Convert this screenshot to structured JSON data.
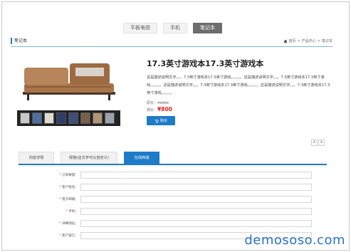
{
  "nav": {
    "tabs": [
      {
        "label": "平板电视",
        "active": false
      },
      {
        "label": "手机",
        "active": false
      },
      {
        "label": "笔记本",
        "active": true
      }
    ]
  },
  "section": {
    "title": "笔记本"
  },
  "breadcrumb": {
    "items": [
      "首页",
      "产品中心",
      "笔记本"
    ],
    "separator": ">"
  },
  "product": {
    "title": "17.3英寸游戏本17.3英寸游戏本",
    "description": "这是描述说明文字。。。7.3英寸游戏本17.3英寸游戏。。。。。。这是描述说明文字。。。7.3英寸游戏本17.3英寸游戏。。。。。。这是描述说明文字。。。7.3英寸游戏本17.3英寸游戏。。。。。。这是描述说明文字。。。7.3英寸游戏本17.3英寸游戏。。。。。。",
    "old_price_label": "原价：",
    "old_price": "¥1000",
    "new_price_label": "现价：",
    "new_price": "¥800",
    "buy_label": "购买"
  },
  "font_controls": {
    "larger": "A",
    "smaller": "A"
  },
  "detail_tabs": [
    {
      "label": "内容详情",
      "active": false
    },
    {
      "label": "规格(这文字可以自定义)",
      "active": false
    },
    {
      "label": "在线商城",
      "active": true
    }
  ],
  "form": {
    "fields": [
      {
        "label": "订单数量："
      },
      {
        "label": "客户姓名："
      },
      {
        "label": "电子邮箱："
      },
      {
        "label": "手机："
      },
      {
        "label": "详细地址："
      },
      {
        "label": "客户留言："
      }
    ]
  },
  "watermark": "demososo.com",
  "colors": {
    "accent": "#1e7bc8",
    "price": "#e02020"
  }
}
